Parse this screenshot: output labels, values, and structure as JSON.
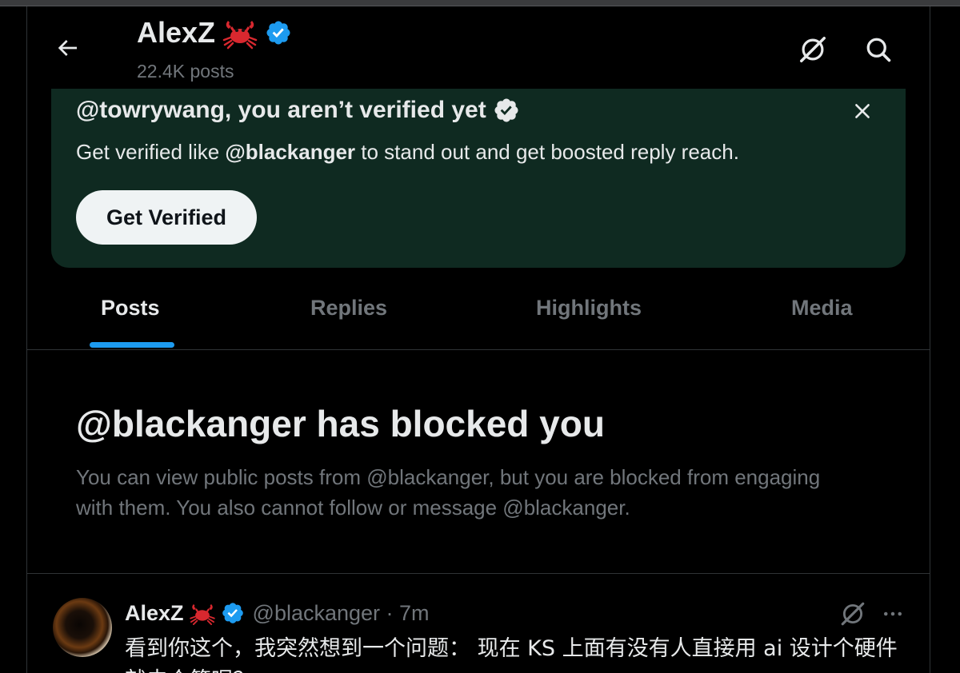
{
  "header": {
    "name": "AlexZ",
    "post_count": "22.4K posts",
    "icons": [
      "back-arrow-icon",
      "crab-emoji-icon",
      "verified-badge-icon",
      "grok-icon",
      "search-icon"
    ]
  },
  "banner": {
    "title": "@towrywang, you aren’t verified yet",
    "text_before": "Get verified like ",
    "text_handle": "@blackanger",
    "text_after": " to stand out and get boosted reply reach.",
    "button_label": "Get Verified",
    "close_icon": "close-icon"
  },
  "tabs": [
    {
      "label": "Posts",
      "active": true
    },
    {
      "label": "Replies",
      "active": false
    },
    {
      "label": "Highlights",
      "active": false
    },
    {
      "label": "Media",
      "active": false
    }
  ],
  "blocked": {
    "title": "@blackanger has blocked you",
    "description": "You can view public posts from @blackanger, but you are blocked from engaging with them. You also cannot follow or message @blackanger."
  },
  "post": {
    "name": "AlexZ",
    "handle_time": "@blackanger · 7m",
    "text": "看到你这个，我突然想到一个问题： 现在 KS 上面有没有人直接用 ai 设计个硬件就去众筹呢？"
  },
  "colors": {
    "background": "#000000",
    "accent": "#1d9bf0",
    "banner_bg": "#0f2a21",
    "muted_text": "#71767b",
    "primary_text": "#e7e9ea"
  }
}
